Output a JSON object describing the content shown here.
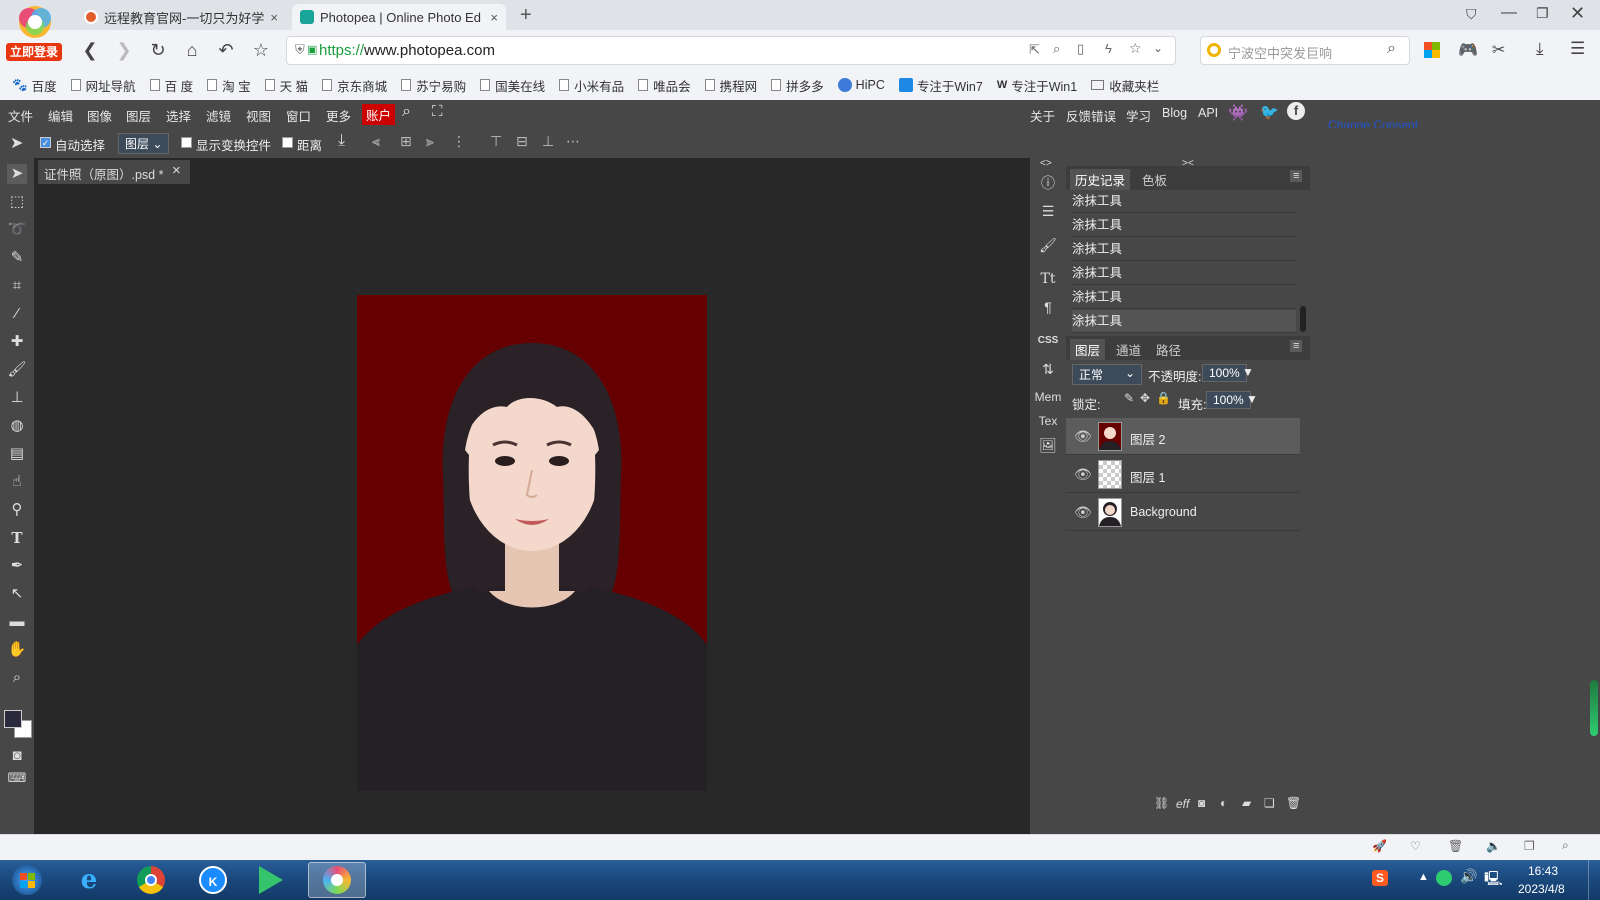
{
  "browser": {
    "login_badge": "立即登录",
    "tabs": [
      {
        "title": "远程教育官网-一切只为好学",
        "close": "×"
      },
      {
        "title": "Photopea | Online Photo Ed",
        "close": "×"
      }
    ],
    "new_tab": "+",
    "url_scheme": "https://",
    "url_host": "www.photopea.com",
    "search_placeholder": "宁波空中突发巨响",
    "bookmarks": [
      "百度",
      "网址导航",
      "百 度",
      "淘 宝",
      "天 猫",
      "京东商城",
      "苏宁易购",
      "国美在线",
      "小米有品",
      "唯品会",
      "携程网",
      "拼多多",
      "HiPC",
      "专注于Win7",
      "专注于Win1",
      "收藏夹栏"
    ]
  },
  "menubar": {
    "items": [
      "文件",
      "编辑",
      "图像",
      "图层",
      "选择",
      "滤镜",
      "视图",
      "窗口",
      "更多"
    ],
    "account": "账户",
    "right_items": [
      "关于",
      "反馈错误",
      "学习",
      "Blog",
      "API"
    ],
    "consent_link": "Change Consent"
  },
  "options_bar": {
    "auto_select_label": "自动选择",
    "auto_select_target": "图层",
    "show_transform_label": "显示变换控件",
    "distance_label": "距离"
  },
  "document": {
    "tab_title": "证件照（原图）.psd *",
    "close": "×"
  },
  "icon_strip": {
    "mem_label": "Mem",
    "tex_label": "Tex",
    "css_label": "CSS",
    "collapse_left": "<>",
    "collapse_right": "><"
  },
  "history_panel": {
    "tabs": [
      "历史记录",
      "色板"
    ],
    "entries": [
      "涂抹工具",
      "涂抹工具",
      "涂抹工具",
      "涂抹工具",
      "涂抹工具",
      "涂抹工具"
    ]
  },
  "layers_panel": {
    "tabs": [
      "图层",
      "通道",
      "路径"
    ],
    "blend_mode": "正常",
    "opacity_label": "不透明度:",
    "opacity_value": "100%",
    "lock_label": "锁定:",
    "fill_label": "填充:",
    "fill_value": "100%",
    "layers": [
      {
        "name": "图层 2",
        "selected": true
      },
      {
        "name": "图层 1",
        "selected": false
      },
      {
        "name": "Background",
        "selected": false
      }
    ],
    "footer_eff": "eff"
  },
  "taskbar": {
    "time": "16:43",
    "date": "2023/4/8"
  },
  "colors": {
    "canvas_background": "#660000",
    "photopea_panel": "#474747",
    "account_button": "#cc0000",
    "url_https": "#1a9f3d"
  }
}
